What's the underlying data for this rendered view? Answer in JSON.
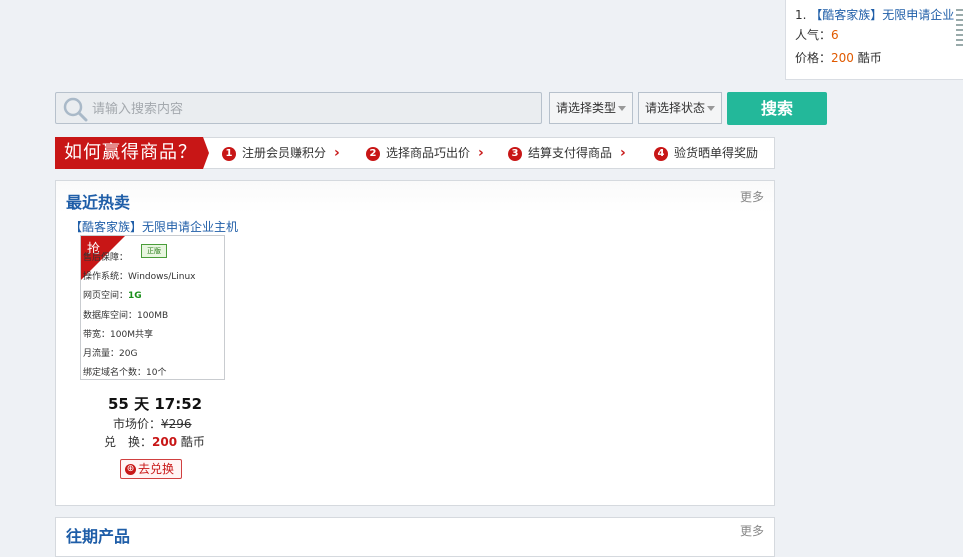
{
  "top_card": {
    "index": "1.",
    "name_bracket": "【酷客家族】",
    "name_rest": "无限申请企业",
    "popularity_label": "人气：",
    "popularity_value": "6",
    "price_label": "价格：",
    "price_value": "200",
    "price_unit": "酷币"
  },
  "search": {
    "placeholder": "请输入搜索内容",
    "type_select": "请选择类型",
    "status_select": "请选择状态",
    "button_label": "搜索"
  },
  "steps": {
    "heading": "如何赢得商品？",
    "items": [
      {
        "num": "1",
        "label": "注册会员赚积分"
      },
      {
        "num": "2",
        "label": "选择商品巧出价"
      },
      {
        "num": "3",
        "label": "结算支付得商品"
      },
      {
        "num": "4",
        "label": "验货晒单得奖励"
      }
    ]
  },
  "hot": {
    "title": "最近热卖",
    "more": "更多",
    "product": {
      "name": "【酷客家族】无限申请企业主机",
      "ribbon": "抢",
      "badge": "正版",
      "specs": [
        {
          "label": "售后保障：",
          "value": ""
        },
        {
          "label": "操作系统：",
          "value": "Windows/Linux"
        },
        {
          "label": "网页空间：",
          "value": "1G"
        },
        {
          "label": "数据库空间：",
          "value": "100MB"
        },
        {
          "label": "带宽：",
          "value": "100M共享"
        },
        {
          "label": "月流量：",
          "value": "20G"
        },
        {
          "label": "绑定域名个数：",
          "value": "10个"
        }
      ],
      "countdown": "55 天 17:52",
      "market_label": "市场价：",
      "market_price": "¥296",
      "exchange_label": "兑　换：",
      "exchange_value": "200",
      "exchange_unit": "酷币",
      "redeem_label": "去兑换"
    }
  },
  "past": {
    "title": "往期产品",
    "more": "更多"
  },
  "colors": {
    "accent_red": "#c81616",
    "search_green": "#23b89a",
    "link_blue": "#1f5ea8"
  }
}
